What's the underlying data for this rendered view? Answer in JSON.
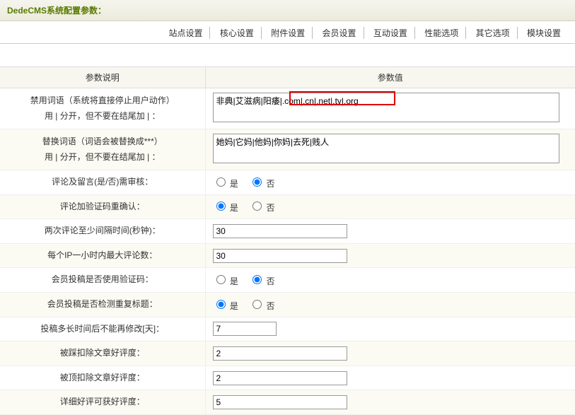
{
  "header": {
    "title": "DedeCMS系统配置参数："
  },
  "tabs": [
    "站点设置",
    "核心设置",
    "附件设置",
    "会员设置",
    "互动设置",
    "性能选项",
    "其它选项",
    "模块设置"
  ],
  "table": {
    "head_left": "参数说明",
    "head_right": "参数值"
  },
  "yes": "是",
  "no": "否",
  "rows": {
    "forbid_words": {
      "label1": "禁用词语（系统将直接停止用户动作）",
      "label2": "用 | 分开，但不要在结尾加 | ：",
      "value": "非典|艾滋病|阳痿|.com|.cn|.net|.tv|.org"
    },
    "replace_words": {
      "label1": "替换词语（词语会被替换成***）",
      "label2": "用 | 分开，但不要在结尾加 | ：",
      "value": "她妈|它妈|他妈|你妈|去死|贱人"
    },
    "comment_audit": {
      "label": "评论及留言(是/否)需审核：",
      "value": "no"
    },
    "comment_captcha": {
      "label": "评论加验证码重确认：",
      "value": "yes"
    },
    "comment_interval": {
      "label": "两次评论至少间隔时间(秒钟)：",
      "value": "30"
    },
    "ip_limit": {
      "label": "每个IP一小时内最大评论数：",
      "value": "30"
    },
    "member_post_captcha": {
      "label": "会员投稿是否使用验证码：",
      "value": "no"
    },
    "member_post_dup": {
      "label": "会员投稿是否检测重复标题：",
      "value": "yes"
    },
    "post_edit_days": {
      "label": "投稿多长时间后不能再修改[天]：",
      "value": "7"
    },
    "stamp_remove": {
      "label": "被踩扣除文章好评度：",
      "value": "2"
    },
    "top_remove": {
      "label": "被顶扣除文章好评度：",
      "value": "2"
    },
    "detail_gain": {
      "label": "详细好评可获好评度：",
      "value": "5"
    }
  }
}
